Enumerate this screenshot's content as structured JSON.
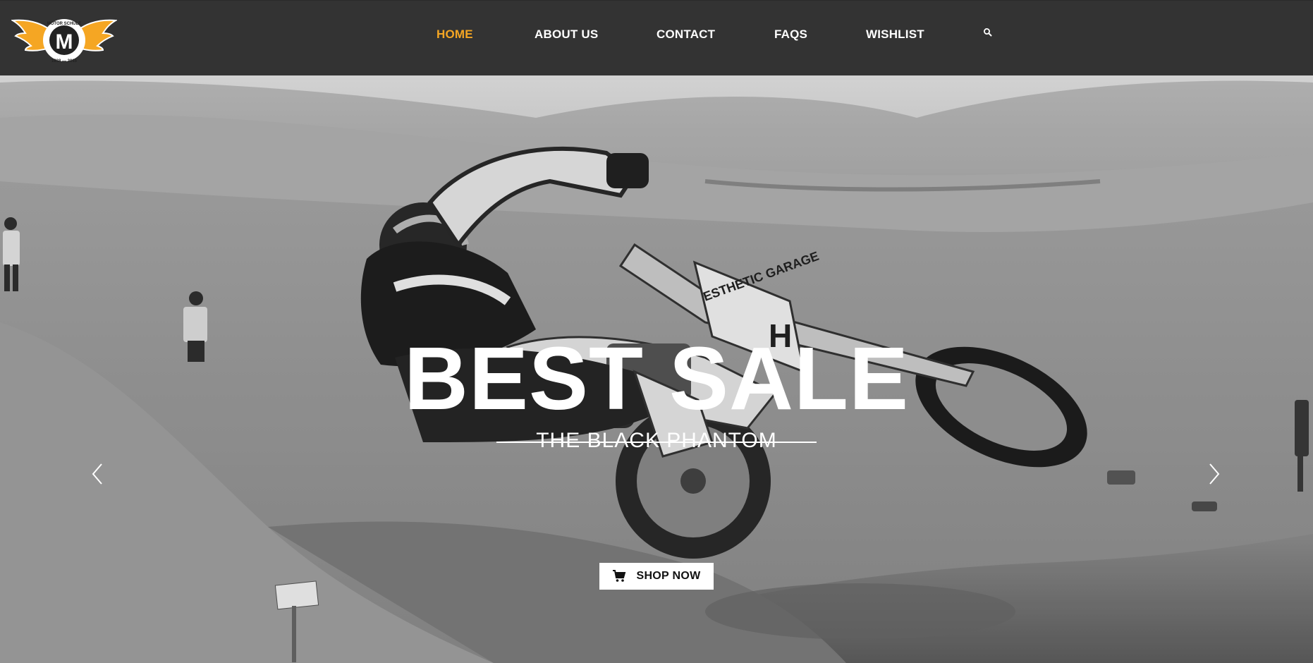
{
  "logo": {
    "top_text": "MOTOR SCHULE",
    "bottom_text": "1938 — 2015",
    "monogram": "M",
    "colors": {
      "wings": "#f5a623",
      "badge": "#ffffff",
      "monogram": "#222222"
    }
  },
  "nav": {
    "items": [
      {
        "label": "HOME",
        "active": true
      },
      {
        "label": "ABOUT US",
        "active": false
      },
      {
        "label": "CONTACT",
        "active": false
      },
      {
        "label": "FAQS",
        "active": false
      },
      {
        "label": "WISHLIST",
        "active": false
      }
    ],
    "search_icon": "search-icon",
    "active_color": "#f5a623",
    "text_color": "#ffffff",
    "background": "#333333"
  },
  "hero": {
    "headline": "BEST SALE",
    "subheadline": "THE BLACK PHANTOM",
    "cta_label": "SHOP NOW",
    "cta_icon": "cart-icon",
    "prev_icon": "chevron-left-icon",
    "next_icon": "chevron-right-icon",
    "image_description_icon": "motocross-rider-photo",
    "bike_plate_text": "ESTHETIC GARAGE",
    "bike_plate_letter": "H"
  }
}
